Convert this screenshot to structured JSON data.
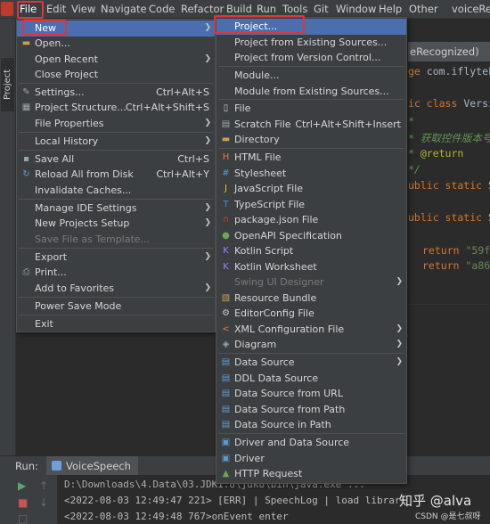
{
  "menubar": {
    "items": [
      "File",
      "Edit",
      "View",
      "Navigate",
      "Code",
      "Refactor",
      "Build",
      "Run",
      "Tools",
      "Git",
      "Window",
      "Help",
      "Other"
    ],
    "window_title": "voiceRe"
  },
  "sidebar": {
    "project_tab": "Project"
  },
  "editor": {
    "tab_title": "eRecognized)",
    "lines": [
      {
        "kw": "ge",
        "rest": " com.iflytek"
      },
      {
        "kw": "ic class",
        "rest": " Version"
      },
      {
        "cm": "*"
      },
      {
        "cm": "* 获取控件版本号"
      },
      {
        "cm": "* ",
        "ann": "@return"
      },
      {
        "cm": "*/"
      },
      {
        "kw": "ublic static",
        "rest": " St"
      },
      {
        "kw": "ublic static",
        "rest": " St"
      },
      {
        "kw": "return",
        "str": " \"59f"
      },
      {
        "kw": "return",
        "str": " \"a864"
      }
    ]
  },
  "file_menu": {
    "items": [
      {
        "label": "New",
        "arrow": true,
        "selected": true,
        "icon": ""
      },
      {
        "label": "Open...",
        "icon": "folder"
      },
      {
        "label": "Open Recent",
        "arrow": true
      },
      {
        "label": "Close Project"
      },
      {
        "label": "Settings...",
        "shortcut": "Ctrl+Alt+S",
        "icon": "wrench"
      },
      {
        "label": "Project Structure...",
        "shortcut": "Ctrl+Alt+Shift+S",
        "icon": "structure"
      },
      {
        "label": "File Properties",
        "arrow": true
      },
      {
        "label": "Local History",
        "arrow": true
      },
      {
        "label": "Save All",
        "shortcut": "Ctrl+S",
        "icon": "save"
      },
      {
        "label": "Reload All from Disk",
        "shortcut": "Ctrl+Alt+Y",
        "icon": "reload"
      },
      {
        "label": "Invalidate Caches..."
      },
      {
        "label": "Manage IDE Settings",
        "arrow": true
      },
      {
        "label": "New Projects Setup",
        "arrow": true
      },
      {
        "label": "Save File as Template...",
        "disabled": true
      },
      {
        "label": "Export",
        "arrow": true
      },
      {
        "label": "Print...",
        "icon": "print"
      },
      {
        "label": "Add to Favorites",
        "arrow": true
      },
      {
        "label": "Power Save Mode"
      },
      {
        "label": "Exit"
      }
    ]
  },
  "new_menu": {
    "items": [
      {
        "label": "Project...",
        "selected": true
      },
      {
        "label": "Project from Existing Sources..."
      },
      {
        "label": "Project from Version Control..."
      },
      {
        "label": "Module..."
      },
      {
        "label": "Module from Existing Sources..."
      },
      {
        "label": "File",
        "icon": "file"
      },
      {
        "label": "Scratch File",
        "shortcut": "Ctrl+Alt+Shift+Insert",
        "icon": "scratch"
      },
      {
        "label": "Directory",
        "icon": "folder"
      },
      {
        "label": "HTML File",
        "icon": "html"
      },
      {
        "label": "Stylesheet",
        "icon": "css"
      },
      {
        "label": "JavaScript File",
        "icon": "js"
      },
      {
        "label": "TypeScript File",
        "icon": "ts"
      },
      {
        "label": "package.json File",
        "icon": "npm"
      },
      {
        "label": "OpenAPI Specification",
        "icon": "openapi"
      },
      {
        "label": "Kotlin Script",
        "icon": "kotlin"
      },
      {
        "label": "Kotlin Worksheet",
        "icon": "kotlin"
      },
      {
        "label": "Swing UI Designer",
        "arrow": true,
        "disabled": true
      },
      {
        "label": "Resource Bundle",
        "icon": "bundle"
      },
      {
        "label": "EditorConfig File",
        "icon": "editorconfig"
      },
      {
        "label": "XML Configuration File",
        "arrow": true,
        "icon": "xml"
      },
      {
        "label": "Diagram",
        "arrow": true,
        "icon": "diagram"
      },
      {
        "label": "Data Source",
        "arrow": true,
        "icon": "db"
      },
      {
        "label": "DDL Data Source",
        "icon": "db"
      },
      {
        "label": "Data Source from URL",
        "icon": "db"
      },
      {
        "label": "Data Source from Path",
        "icon": "db"
      },
      {
        "label": "Data Source in Path",
        "icon": "db"
      },
      {
        "label": "Driver and Data Source",
        "icon": "driver"
      },
      {
        "label": "Driver",
        "icon": "driver"
      },
      {
        "label": "HTTP Request",
        "icon": "api"
      }
    ]
  },
  "run_panel": {
    "label": "Run:",
    "tab": "VoiceSpeech",
    "console_lines": [
      "D:\\Downloads\\4.Data\\03.JDK1.8\\jdk8\\bin\\java.exe ...",
      "<2022-08-03 12:49:47 221> [ERR] | SpeechLog | load librar",
      "<2022-08-03 12:49:48 767>onEvent enter"
    ]
  },
  "watermark": {
    "main": "知乎 @alva",
    "sub": "CSDN @是七叔呀"
  },
  "colors": {
    "selection": "#4b6eaf",
    "menu_bg": "#3c3f41",
    "highlight_box": "#e0343d"
  }
}
